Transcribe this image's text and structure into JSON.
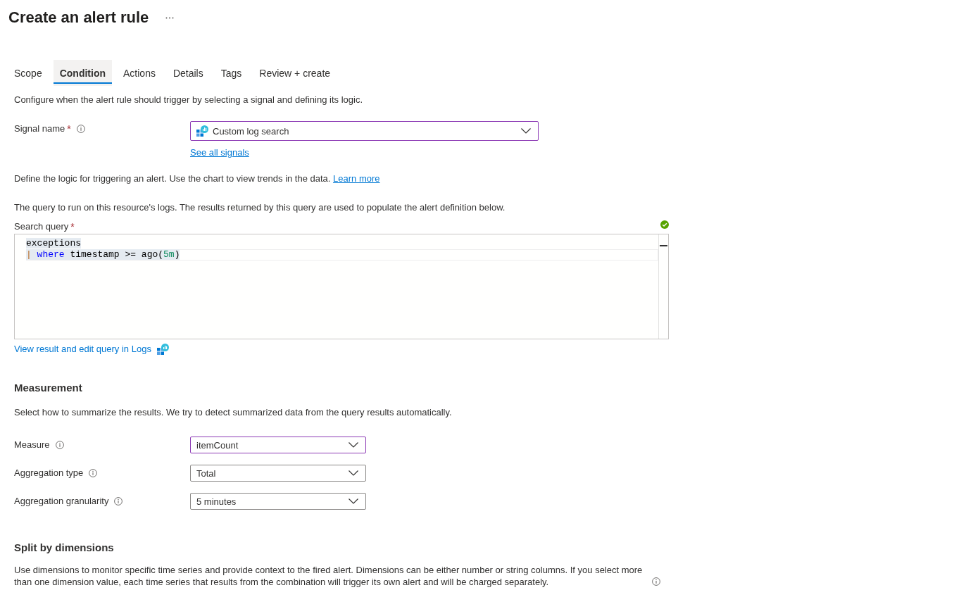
{
  "header": {
    "title": "Create an alert rule"
  },
  "tabs": [
    {
      "label": "Scope",
      "selected": false
    },
    {
      "label": "Condition",
      "selected": true
    },
    {
      "label": "Actions",
      "selected": false
    },
    {
      "label": "Details",
      "selected": false
    },
    {
      "label": "Tags",
      "selected": false
    },
    {
      "label": "Review + create",
      "selected": false
    }
  ],
  "intro": "Configure when the alert rule should trigger by selecting a signal and defining its logic.",
  "signal": {
    "label": "Signal name",
    "required_mark": "*",
    "value": "Custom log search",
    "highlighted": true,
    "link": "See all signals"
  },
  "logic": {
    "text": "Define the logic for triggering an alert. Use the chart to view trends in the data.",
    "link": "Learn more"
  },
  "query": {
    "description": "The query to run on this resource's logs. The results returned by this query are used to populate the alert definition below.",
    "label": "Search query",
    "required_mark": "*",
    "valid": true,
    "lines": [
      {
        "selected": true,
        "current": false,
        "tokens": [
          {
            "kind": "plain",
            "text": "exceptions"
          }
        ]
      },
      {
        "selected": true,
        "current": true,
        "tokens": [
          {
            "kind": "pipe",
            "text": "| "
          },
          {
            "kind": "keyword",
            "text": "where"
          },
          {
            "kind": "plain",
            "text": " timestamp >= ago("
          },
          {
            "kind": "number",
            "text": "5m"
          },
          {
            "kind": "plain",
            "text": ")"
          }
        ]
      }
    ],
    "logs_link": "View result and edit query in Logs"
  },
  "measurement": {
    "heading": "Measurement",
    "description": "Select how to summarize the results. We try to detect summarized data from the query results automatically.",
    "fields": [
      {
        "label": "Measure",
        "value": "itemCount",
        "highlighted": true
      },
      {
        "label": "Aggregation type",
        "value": "Total",
        "highlighted": false
      },
      {
        "label": "Aggregation granularity",
        "value": "5 minutes",
        "highlighted": false
      }
    ]
  },
  "split": {
    "heading": "Split by dimensions",
    "description": "Use dimensions to monitor specific time series and provide context to the fired alert. Dimensions can be either number or string columns. If you select more than one dimension value, each time series that results from the combination will trigger its own alert and will be charged separately."
  }
}
